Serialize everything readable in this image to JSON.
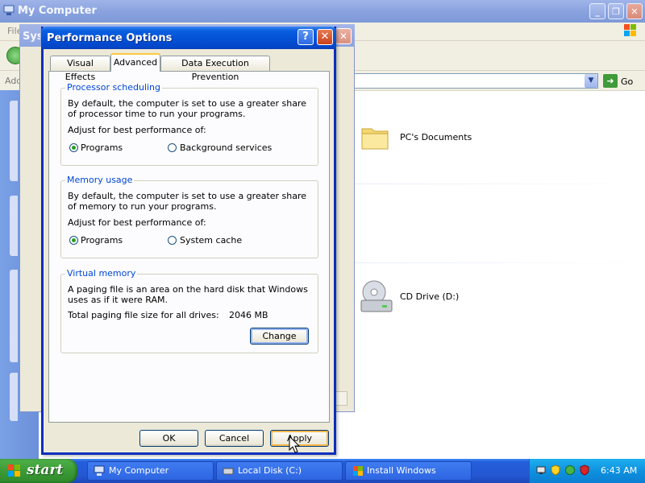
{
  "mycomputer": {
    "title": "My Computer",
    "menu_file": "File",
    "address_label": "Address",
    "go_label": "Go",
    "items": [
      {
        "label": "PC's Documents",
        "icon": "folder-icon"
      },
      {
        "label": "CD Drive (D:)",
        "icon": "cd-drive-icon"
      }
    ]
  },
  "sysprops": {
    "title": "System Properties"
  },
  "perf": {
    "title": "Performance Options",
    "help_label": "?",
    "close_label": "✕",
    "tabs": [
      {
        "label": "Visual Effects"
      },
      {
        "label": "Advanced"
      },
      {
        "label": "Data Execution Prevention"
      }
    ],
    "processor": {
      "title": "Processor scheduling",
      "desc": "By default, the computer is set to use a greater share of processor time to run your programs.",
      "adjust": "Adjust for best performance of:",
      "opt1": "Programs",
      "opt2": "Background services",
      "selected": "Programs"
    },
    "memory": {
      "title": "Memory usage",
      "desc": "By default, the computer is set to use a greater share of memory to run your programs.",
      "adjust": "Adjust for best performance of:",
      "opt1": "Programs",
      "opt2": "System cache",
      "selected": "Programs"
    },
    "vm": {
      "title": "Virtual memory",
      "desc": "A paging file is an area on the hard disk that Windows uses as if it were RAM.",
      "total_label": "Total paging file size for all drives:",
      "total_value": "2046 MB",
      "change_label": "Change"
    },
    "buttons": {
      "ok": "OK",
      "cancel": "Cancel",
      "apply": "Apply"
    }
  },
  "taskbar": {
    "start": "start",
    "tasks": [
      {
        "label": "My Computer"
      },
      {
        "label": "Local Disk (C:)"
      },
      {
        "label": "Install Windows"
      }
    ],
    "clock": "6:43 AM"
  }
}
